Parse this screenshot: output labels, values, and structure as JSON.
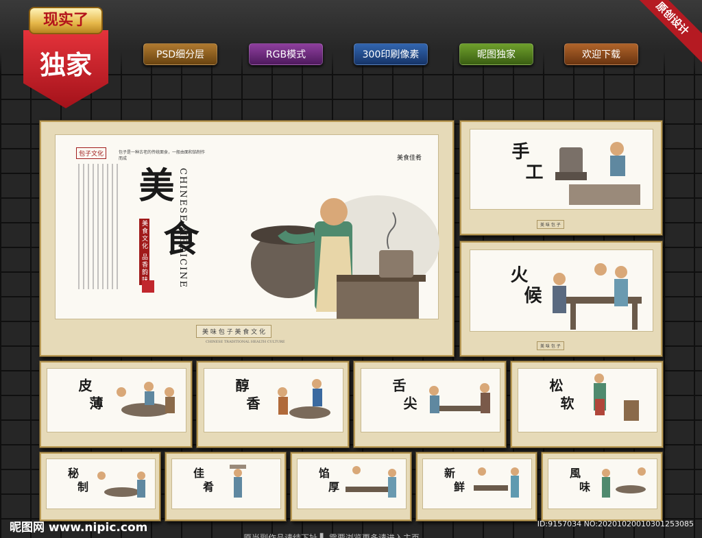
{
  "badge": {
    "top": "现实了",
    "main": "独家"
  },
  "corner": "原创设计",
  "pills": [
    {
      "label": "PSD细分层",
      "color": "#8a5d1a"
    },
    {
      "label": "RGB模式",
      "color": "#6a2a7a"
    },
    {
      "label": "300印刷像素",
      "color": "#1e4a8c"
    },
    {
      "label": "昵图独家",
      "color": "#4f7a1e"
    },
    {
      "label": "欢迎下载",
      "color": "#8a4a16"
    }
  ],
  "main_panel": {
    "tag": "包子文化",
    "title1": "美",
    "title2": "食",
    "latin": "CHINESE MEDICINE",
    "vertical_sub": "美食文化 品香韵味",
    "side_logo": "美食佳肴",
    "bottom_banner": "美 味 包 子 美 食 文 化",
    "bottom_latin": "CHINESE TRADITIONAL HEALTH CULTURE",
    "intro": "包子是一种古老的传统面食，一般由面和馅制作而成"
  },
  "panels": [
    {
      "t1": "手",
      "t2": "工"
    },
    {
      "t1": "火",
      "t2": "候"
    },
    {
      "t1": "皮",
      "t2": "薄"
    },
    {
      "t1": "醇",
      "t2": "香"
    },
    {
      "t1": "舌",
      "t2": "尖"
    },
    {
      "t1": "松",
      "t2": "软"
    },
    {
      "t1": "秘",
      "t2": "制"
    },
    {
      "t1": "佳",
      "t2": "肴"
    },
    {
      "t1": "馅",
      "t2": "厚"
    },
    {
      "t1": "新",
      "t2": "鲜"
    },
    {
      "t1": "風",
      "t2": "味"
    }
  ],
  "footer": {
    "site": "昵图网 www.nipic.com",
    "id": "ID:9157034 NO:20201020010301253085",
    "note": "原当副作品请结下扯 ▌ 需要浏览更多请进入主页"
  }
}
